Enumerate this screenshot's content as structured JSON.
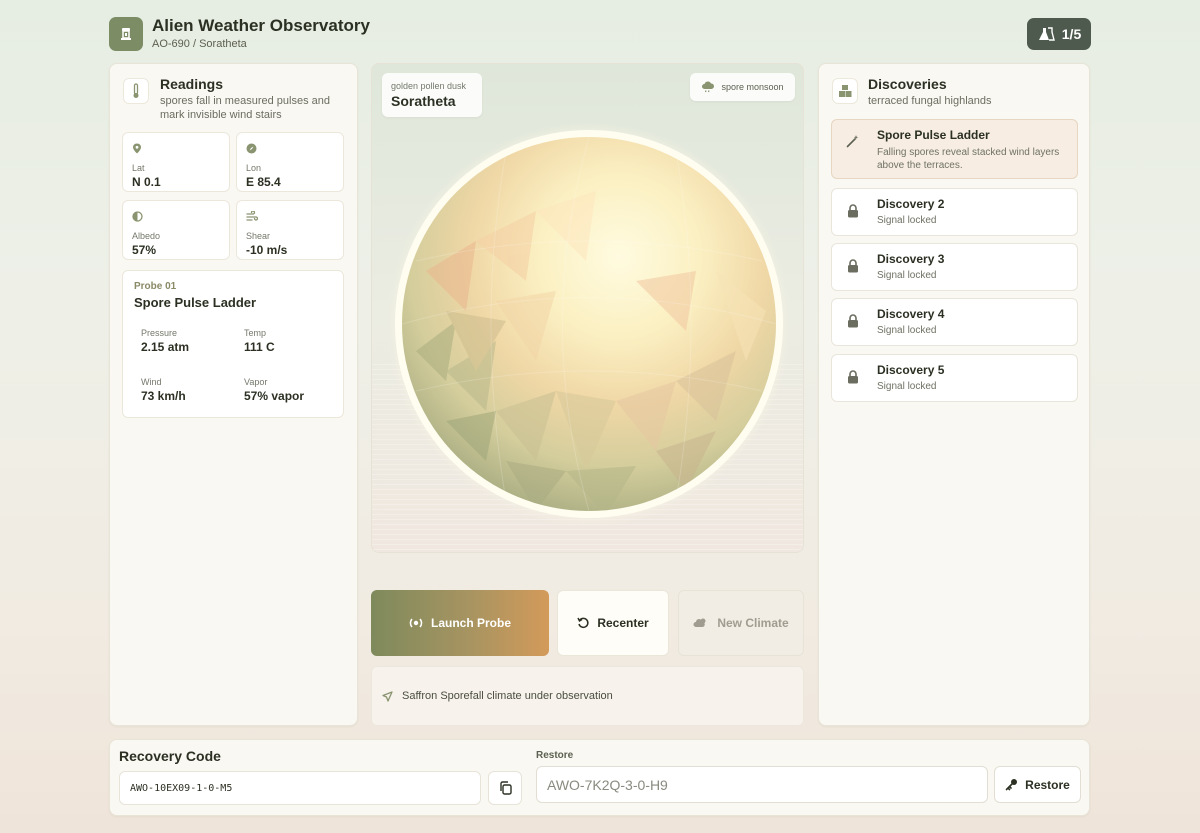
{
  "header": {
    "title": "Alien Weather Observatory",
    "subtitle": "AO-690 / Soratheta",
    "progress": "1/5"
  },
  "readings": {
    "title": "Readings",
    "description": "spores fall in measured pulses and mark invisible wind stairs",
    "stats": [
      {
        "icon": "map-pin-icon",
        "label": "Lat",
        "value": "N 0.1"
      },
      {
        "icon": "compass-icon",
        "label": "Lon",
        "value": "E 85.4"
      },
      {
        "icon": "half-circle-icon",
        "label": "Albedo",
        "value": "57%"
      },
      {
        "icon": "wind-icon",
        "label": "Shear",
        "value": "-10 m/s"
      }
    ],
    "probe": {
      "label": "Probe 01",
      "name": "Spore Pulse Ladder",
      "metrics": [
        {
          "label": "Pressure",
          "value": "2.15 atm"
        },
        {
          "label": "Temp",
          "value": "111 C"
        },
        {
          "label": "Wind",
          "value": "73 km/h"
        },
        {
          "label": "Vapor",
          "value": "57% vapor"
        }
      ]
    }
  },
  "viewport": {
    "time_label": "golden pollen dusk",
    "planet_name": "Soratheta",
    "weather_chip": "spore monsoon"
  },
  "actions": {
    "launch": "Launch Probe",
    "recenter": "Recenter",
    "new_climate": "New Climate"
  },
  "status": {
    "message": "Saffron Sporefall climate under observation"
  },
  "discoveries": {
    "title": "Discoveries",
    "subtitle": "terraced fungal highlands",
    "items": [
      {
        "name": "Spore Pulse Ladder",
        "detail": "Falling spores reveal stacked wind layers above the terraces.",
        "unlocked": true
      },
      {
        "name": "Discovery 2",
        "detail": "Signal locked",
        "unlocked": false
      },
      {
        "name": "Discovery 3",
        "detail": "Signal locked",
        "unlocked": false
      },
      {
        "name": "Discovery 4",
        "detail": "Signal locked",
        "unlocked": false
      },
      {
        "name": "Discovery 5",
        "detail": "Signal locked",
        "unlocked": false
      }
    ]
  },
  "recovery": {
    "title": "Recovery Code",
    "code": "AWO-10EX09-1-0-M5",
    "restore_label": "Restore",
    "restore_placeholder": "AWO-7K2Q-3-0-H9",
    "restore_button": "Restore"
  },
  "colors": {
    "accent": "#7c8c64",
    "launch_gradient_start": "#7e8a5c",
    "launch_gradient_end": "#d39a5a",
    "counter_bg": "#4e5a4e"
  }
}
